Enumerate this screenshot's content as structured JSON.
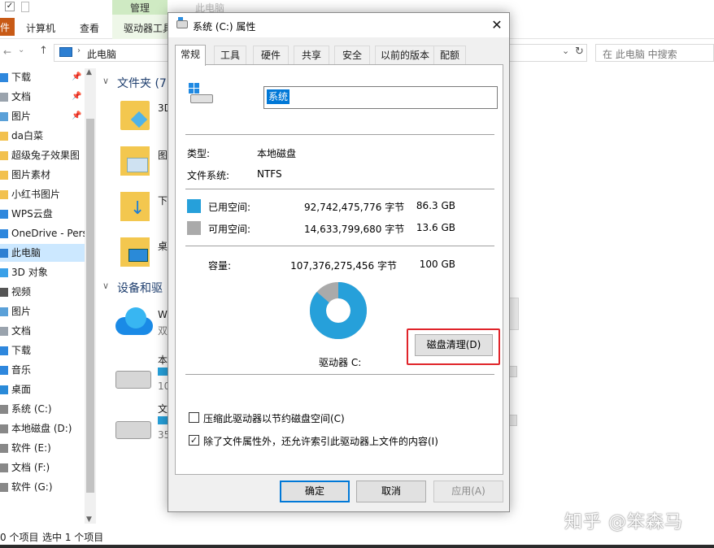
{
  "explorer": {
    "ribbon_tabs": {
      "file": "件",
      "computer": "计算机",
      "view": "查看",
      "drive_tools": "驱动器工具"
    },
    "context": {
      "manage": "管理",
      "this_pc": "此电脑"
    },
    "address": "此电脑",
    "search_placeholder": "在 此电脑 中搜索",
    "sidebar": [
      {
        "label": "下载",
        "pinned": true
      },
      {
        "label": "文档",
        "pinned": true
      },
      {
        "label": "图片",
        "pinned": true
      },
      {
        "label": "da白菜"
      },
      {
        "label": "超级兔子效果图"
      },
      {
        "label": "图片素材"
      },
      {
        "label": "小红书图片"
      },
      {
        "label": "WPS云盘"
      },
      {
        "label": "OneDrive - Perso"
      },
      {
        "label": "此电脑",
        "selected": true
      },
      {
        "label": "3D 对象"
      },
      {
        "label": "视频"
      },
      {
        "label": "图片"
      },
      {
        "label": "文档"
      },
      {
        "label": "下载"
      },
      {
        "label": "音乐"
      },
      {
        "label": "桌面"
      },
      {
        "label": "系统 (C:)"
      },
      {
        "label": "本地磁盘 (D:)"
      },
      {
        "label": "软件 (E:)"
      },
      {
        "label": "文档 (F:)"
      },
      {
        "label": "软件 (G:)"
      }
    ],
    "folders_header": "文件夹 (7",
    "devices_header": "设备和驱",
    "folder_labels": [
      "3D",
      "图",
      "下",
      "桌"
    ],
    "device_labels": [
      "W",
      "双",
      "本",
      "10",
      "文",
      "35"
    ],
    "status": {
      "items": "0 个项目",
      "selected": "选中 1 个项目"
    }
  },
  "dialog": {
    "title": "系统 (C:) 属性",
    "tabs": [
      "常规",
      "工具",
      "硬件",
      "共享",
      "安全",
      "以前的版本",
      "配额"
    ],
    "active_tab": "常规",
    "volume_name": "系统",
    "type_label": "类型:",
    "type_value": "本地磁盘",
    "fs_label": "文件系统:",
    "fs_value": "NTFS",
    "used": {
      "label": "已用空间:",
      "bytes": "92,742,475,776 字节",
      "size": "86.3 GB",
      "color": "#26a0da"
    },
    "free": {
      "label": "可用空间:",
      "bytes": "14,633,799,680 字节",
      "size": "13.6 GB",
      "color": "#aaaaaa"
    },
    "capacity": {
      "label": "容量:",
      "bytes": "107,376,275,456 字节",
      "size": "100 GB"
    },
    "used_fraction": 0.863,
    "drive_label": "驱动器 C:",
    "cleanup_button": "磁盘清理(D)",
    "compress_option": {
      "label": "压缩此驱动器以节约磁盘空间(C)",
      "checked": false
    },
    "index_option": {
      "label": "除了文件属性外，还允许索引此驱动器上文件的内容(I)",
      "checked": true
    },
    "ok": "确定",
    "cancel": "取消",
    "apply": "应用(A)"
  },
  "watermark": "知乎 @笨森马"
}
